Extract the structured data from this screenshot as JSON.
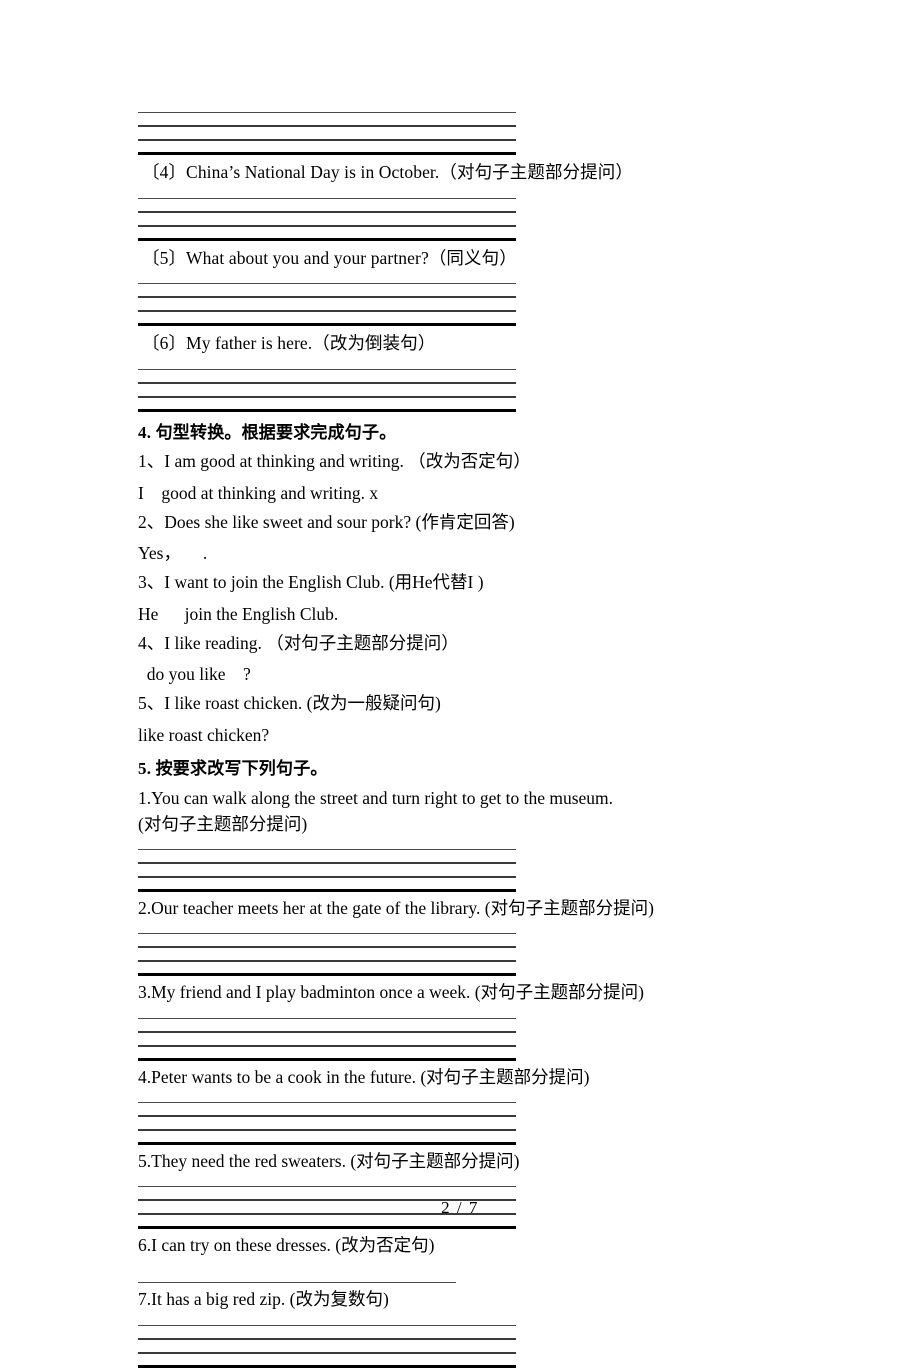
{
  "page": {
    "footer": "2 / 7"
  },
  "top_block": {
    "lines": 4
  },
  "exercise3_items": [
    {
      "id": "item-4",
      "text": "〔4〕China’s National Day is in October.（对句子主题部分提问）",
      "lines": 4
    },
    {
      "id": "item-5",
      "text": "〔5〕What about you and your partner?（同义句）",
      "lines": 4
    },
    {
      "id": "item-6",
      "text": "〔6〕My father is here.（改为倒装句）",
      "lines": 4
    }
  ],
  "section4": {
    "heading": "4. 句型转换。根据要求完成句子。",
    "items": [
      {
        "prompt": "1、I am good at thinking and writing. （改为否定句）",
        "answer": "I    good at thinking and writing. x"
      },
      {
        "prompt": "2、Does she like sweet and sour pork? (作肯定回答)",
        "answer": "Yes，     ."
      },
      {
        "prompt": "3、I want to join the English Club. (用He代替I )",
        "answer": "He      join the English Club."
      },
      {
        "prompt": "4、I like reading. （对句子主题部分提问）",
        "answer": "  do you like    ?"
      },
      {
        "prompt": "5、I like roast chicken. (改为一般疑问句)",
        "answer": "like roast chicken?"
      }
    ]
  },
  "section5": {
    "heading": "5. 按要求改写下列句子。",
    "items": [
      {
        "text": "1.You can walk along the street and turn right to get to the museum.\n(对句子主题部分提问)",
        "lines": 4,
        "width": "wide"
      },
      {
        "text": "2.Our teacher meets her at the gate of the library. (对句子主题部分提问)",
        "lines": 4,
        "width": "wide"
      },
      {
        "text": "3.My friend and I play badminton once a week. (对句子主题部分提问)",
        "lines": 4,
        "width": "wide"
      },
      {
        "text": "4.Peter wants to be a cook in the future. (对句子主题部分提问)",
        "lines": 4,
        "width": "wide"
      },
      {
        "text": "5.They need the red sweaters. (对句子主题部分提问)",
        "lines": 4,
        "width": "wide"
      },
      {
        "text": "6.I can try on these dresses. (改为否定句)",
        "lines": 1,
        "width": "short"
      },
      {
        "text": "7.It has a big red zip. (改为复数句)",
        "lines": 4,
        "width": "wide"
      }
    ]
  }
}
